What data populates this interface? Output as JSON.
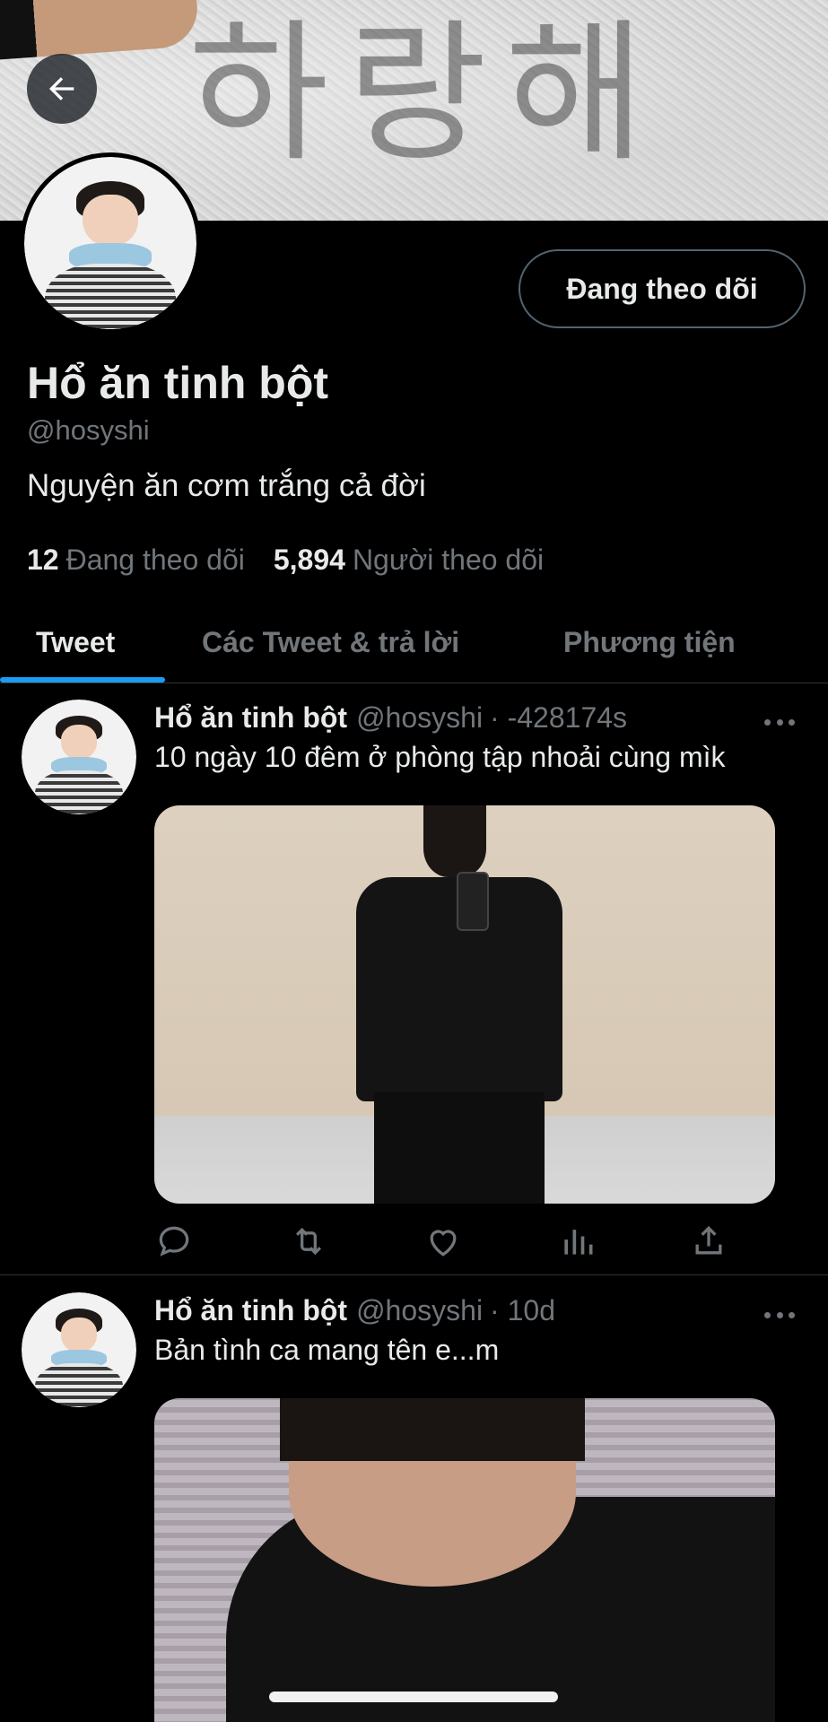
{
  "profile": {
    "banner_text": "하랑해",
    "display_name": "Hổ ăn tinh bột",
    "handle": "@hosyshi",
    "bio": "Nguyện ăn cơm trắng cả đời",
    "follow_button": "Đang theo dõi",
    "following_count": "12",
    "following_label": "Đang theo dõi",
    "followers_count": "5,894",
    "followers_label": "Người theo dõi"
  },
  "tabs": [
    {
      "label": "Tweet",
      "active": true
    },
    {
      "label": "Các Tweet & trả lời",
      "active": false
    },
    {
      "label": "Phương tiện",
      "active": false
    }
  ],
  "tweets": [
    {
      "name": "Hổ ăn tinh bột",
      "handle": "@hosyshi",
      "time": "· -428174s",
      "text": "10 ngày 10 đêm ở phòng tập nhoải cùng mìk"
    },
    {
      "name": "Hổ ăn tinh bột",
      "handle": "@hosyshi",
      "time": "· 10d",
      "text": "Bản tình ca mang tên e...m"
    }
  ],
  "icons": {
    "back": "arrow-left-icon",
    "reply": "reply-icon",
    "retweet": "retweet-icon",
    "like": "heart-icon",
    "analytics": "analytics-icon",
    "share": "share-icon",
    "more": "more-icon"
  },
  "colors": {
    "background": "#000000",
    "text": "#e7e9ea",
    "secondary": "#71767b",
    "accent": "#1d9bf0",
    "border": "#2f3336"
  }
}
